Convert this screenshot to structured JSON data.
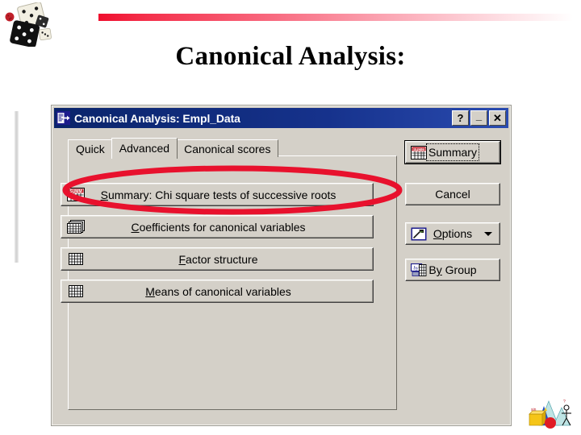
{
  "slide": {
    "title": "Canonical Analysis:",
    "accent_color": "#ef0f2e",
    "decorations": {
      "dice_clipart": "dice-clipart",
      "corner_clipart": "geometry-clipart",
      "gradient_bar": "red-gradient-bar",
      "left_rule": "vertical-rule"
    }
  },
  "dialog": {
    "title": "Canonical Analysis: Empl_Data",
    "titlebar_color": "#0a246a",
    "window_icon": "canonical-analysis-icon",
    "window_buttons": [
      {
        "name": "help-button",
        "label": "?"
      },
      {
        "name": "minimize-button",
        "label": "_"
      },
      {
        "name": "close-button",
        "label": "✕"
      }
    ],
    "tabs": [
      {
        "label": "Quick",
        "active": false
      },
      {
        "label": "Advanced",
        "active": true
      },
      {
        "label": "Canonical scores",
        "active": false
      }
    ],
    "main_buttons": [
      {
        "label_prefix": "",
        "accel": "S",
        "label_rest": "ummary:  Chi square tests of successive roots",
        "icon": "summary-table-icon",
        "name": "summary-chi-square-button",
        "highlighted": true
      },
      {
        "label_prefix": "",
        "accel": "C",
        "label_rest": "oefficients for canonical variables",
        "icon": "multi-table-icon",
        "name": "coefficients-button",
        "highlighted": false
      },
      {
        "label_prefix": "",
        "accel": "F",
        "label_rest": "actor structure",
        "icon": "table-icon",
        "name": "factor-structure-button",
        "highlighted": false
      },
      {
        "label_prefix": "",
        "accel": "M",
        "label_rest": "eans of canonical variables",
        "icon": "table-icon",
        "name": "means-button",
        "highlighted": false
      }
    ],
    "side_buttons": [
      {
        "label_prefix": "S",
        "accel": "",
        "label_rest": "ummary",
        "icon": "summary-table-icon",
        "name": "summary-button",
        "default": true,
        "focused": true,
        "caret": false
      },
      {
        "label_prefix": "Cancel",
        "accel": "",
        "label_rest": "",
        "icon": "",
        "name": "cancel-button",
        "default": false,
        "focused": false,
        "caret": false
      },
      {
        "label_prefix": "",
        "accel": "O",
        "label_rest": "ptions",
        "icon": "options-hammer-icon",
        "name": "options-button",
        "default": false,
        "focused": false,
        "caret": true
      },
      {
        "label_prefix": "B",
        "accel": "y",
        "label_rest": " Group",
        "icon": "by-group-icon",
        "name": "by-group-button",
        "default": false,
        "focused": false,
        "caret": false
      }
    ]
  },
  "annotation": {
    "type": "ellipse",
    "color": "#e8112d",
    "target": "summary-chi-square-button"
  }
}
